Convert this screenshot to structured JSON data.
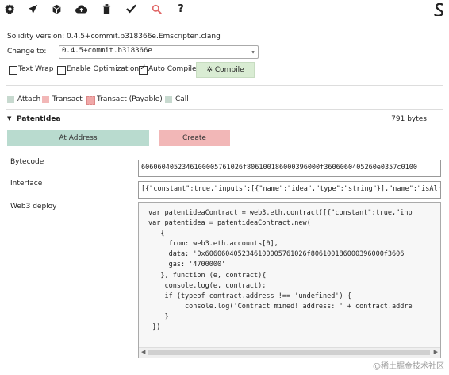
{
  "toolbar": {
    "icons": [
      "gear-icon",
      "send-icon",
      "cube-icon",
      "cloud-upload-icon",
      "trash-icon",
      "check-icon",
      "search-icon",
      "help-icon"
    ],
    "help_glyph": "?",
    "logo": "remix-logo-icon"
  },
  "compiler": {
    "version_label": "Solidity version:",
    "version_value": "0.4.5+commit.b318366e.Emscripten.clang",
    "change_label": "Change to:",
    "change_value": "0.4.5+commit.b318366e"
  },
  "options": {
    "text_wrap": "Text Wrap",
    "enable_optimization": "Enable Optimization",
    "auto_compile": "Auto Compile",
    "auto_compile_checked": true,
    "compile_button": "Compile"
  },
  "legend": {
    "attach": "Attach",
    "transact": "Transact",
    "transact_payable": "Transact (Payable)",
    "call": "Call",
    "colors": {
      "attach": "#c7d9cf",
      "transact": "#f2b7b7",
      "transact_payable": "#f0a8a8",
      "call": "#c7d9cf"
    }
  },
  "contract": {
    "name": "PatentIdea",
    "size": "791 bytes",
    "at_address": "At Address",
    "create": "Create"
  },
  "fields": {
    "bytecode_label": "Bytecode",
    "bytecode_value": "6060604052346100005761026f806100186000396000f3606060405260e0357c0100",
    "interface_label": "Interface",
    "interface_value": "[{\"constant\":true,\"inputs\":[{\"name\":\"idea\",\"type\":\"string\"}],\"name\":\"isAlreadyHashe",
    "web3_label": "Web3 deploy"
  },
  "web3_code": [
    "var patentideaContract = web3.eth.contract([{\"constant\":true,\"inp",
    "var patentidea = patentideaContract.new(",
    "   {",
    "     from: web3.eth.accounts[0],",
    "     data: '0x6060604052346100005761026f806100186000396000f3606",
    "     gas: '4700000'",
    "   }, function (e, contract){",
    "    console.log(e, contract);",
    "    if (typeof contract.address !== 'undefined') {",
    "         console.log('Contract mined! address: ' + contract.addre",
    "    }",
    " })"
  ],
  "watermark": "@稀土掘金技术社区"
}
